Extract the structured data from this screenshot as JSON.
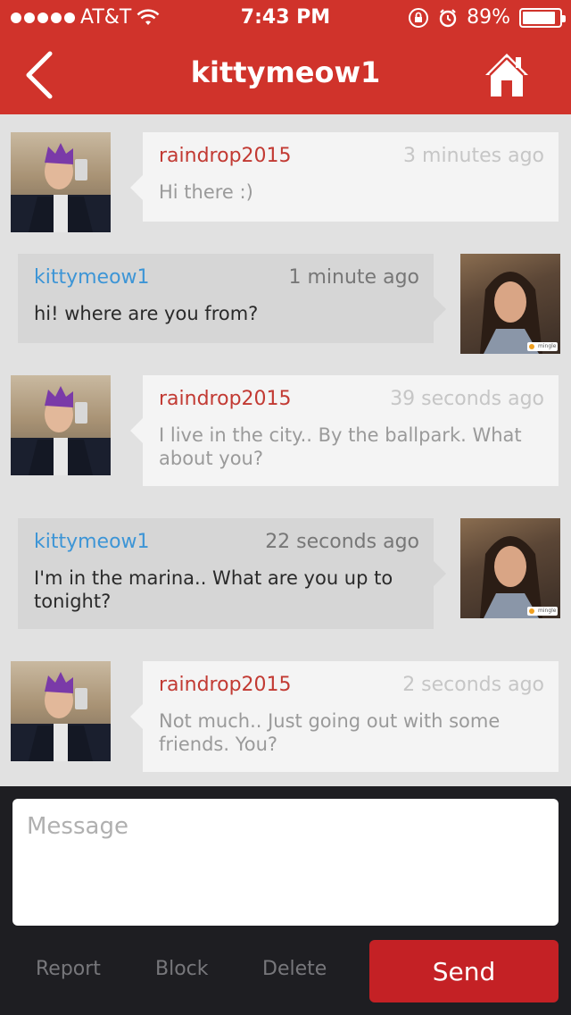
{
  "status_bar": {
    "carrier": "AT&T",
    "time": "7:43 PM",
    "battery": "89%",
    "battery_level": 0.89
  },
  "header": {
    "title": "kittymeow1",
    "back_icon": "chevron-left-icon",
    "home_icon": "home-icon"
  },
  "messages": [
    {
      "direction": "in",
      "sender": "raindrop2015",
      "time": "3 minutes ago",
      "text": "Hi there :)"
    },
    {
      "direction": "out",
      "sender": "kittymeow1",
      "time": "1 minute ago",
      "text": "hi! where are you from?"
    },
    {
      "direction": "in",
      "sender": "raindrop2015",
      "time": "39 seconds ago",
      "text": "I live in the city.. By the ballpark. What about you?"
    },
    {
      "direction": "out",
      "sender": "kittymeow1",
      "time": "22 seconds ago",
      "text": "I'm in the marina.. What are you up to tonight?"
    },
    {
      "direction": "in",
      "sender": "raindrop2015",
      "time": "2 seconds ago",
      "text": "Not much.. Just going out with some friends.  You?"
    }
  ],
  "composer": {
    "placeholder": "Message",
    "value": "",
    "report_label": "Report",
    "block_label": "Block",
    "delete_label": "Delete",
    "send_label": "Send"
  },
  "avatar_badge": "mingle",
  "colors": {
    "header": "#d0332b",
    "incoming_name": "#c23a33",
    "outgoing_name": "#3d95d6",
    "send_button": "#c42125",
    "composer_bg": "#1e1e22"
  }
}
